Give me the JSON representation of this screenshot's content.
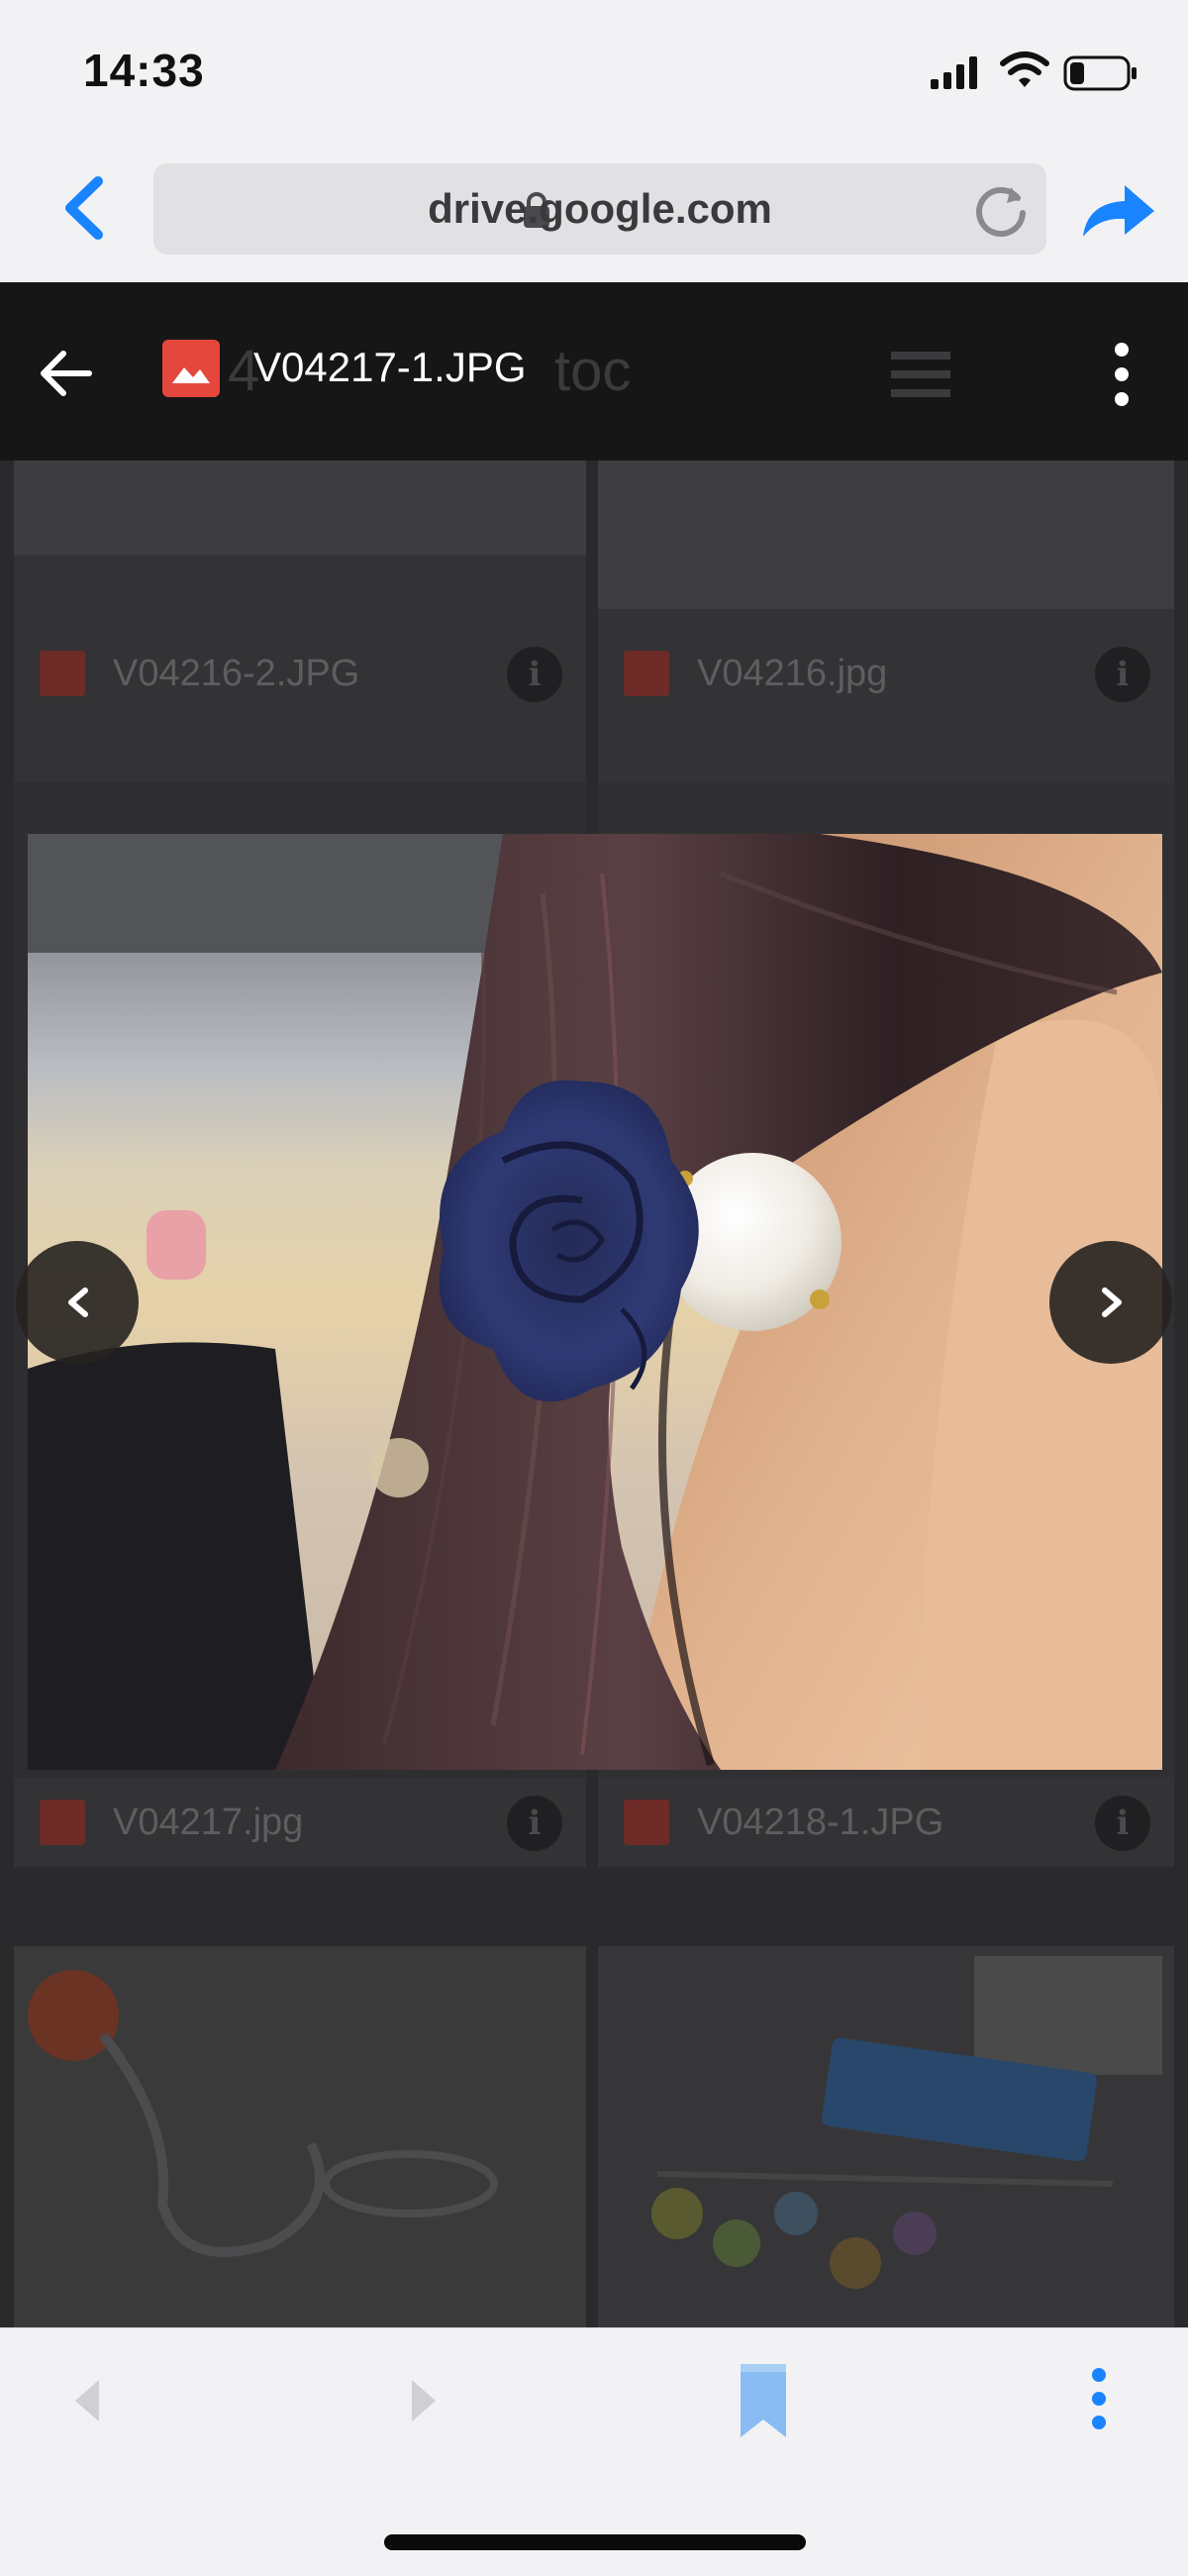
{
  "status_bar": {
    "time": "14:33"
  },
  "browser": {
    "url": "drive.google.com"
  },
  "viewer": {
    "file_name": "V04217-1.JPG",
    "background_ghost": [
      "4",
      "toc"
    ]
  },
  "grid_files": [
    {
      "name": "V04216-2.JPG"
    },
    {
      "name": "V04216.jpg"
    },
    {
      "name": "V04217.jpg"
    },
    {
      "name": "V04218-1.JPG"
    }
  ],
  "photo": {
    "description_icon": "hair-tie-photo"
  },
  "colors": {
    "accent": "#1a84ff",
    "viewer_header": "#161617",
    "file_icon": "#e5473d",
    "bookmark": "#88bcf2"
  }
}
